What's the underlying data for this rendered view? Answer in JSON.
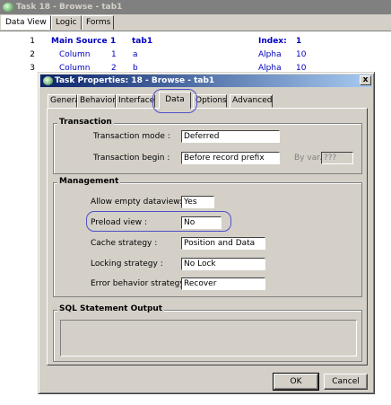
{
  "outer": {
    "title": "Task 18 -  Browse - tab1",
    "tabs": [
      "Data View",
      "Logic",
      "Forms"
    ],
    "rows": [
      {
        "num": "1",
        "c1": "Main Source",
        "c2": "1",
        "c3": "tab1",
        "c4": "Index:",
        "c5": "1"
      },
      {
        "num": "2",
        "c1": "Column",
        "c2": "1",
        "c3": "a",
        "c4": "Alpha",
        "c5": "10"
      },
      {
        "num": "3",
        "c1": "Column",
        "c2": "2",
        "c3": "b",
        "c4": "Alpha",
        "c5": "10"
      }
    ]
  },
  "dialog": {
    "title": "Task Properties: 18 -  Browse - tab1",
    "close_label": "x",
    "tabs": [
      "General",
      "Behavior",
      "Interface",
      "Data",
      "Options",
      "Advanced"
    ],
    "transaction": {
      "title": "Transaction",
      "mode_label": "Transaction mode :",
      "mode_value": "Deferred",
      "begin_label": "Transaction begin :",
      "begin_value": "Before record prefix",
      "byvar_label": "By var.:",
      "byvar_value": "???"
    },
    "management": {
      "title": "Management",
      "allow_empty_label": "Allow empty dataview:",
      "allow_empty_value": "Yes",
      "preload_label": "Preload view :",
      "preload_value": "No",
      "cache_label": "Cache strategy :",
      "cache_value": "Position and Data",
      "locking_label": "Locking strategy :",
      "locking_value": "No Lock",
      "error_label": "Error behavior strategy :",
      "error_value": "Recover"
    },
    "sql": {
      "title": "SQL Statement Output"
    },
    "ok_label": "OK",
    "cancel_label": "Cancel"
  },
  "colors": {
    "title_active": "#0a246a",
    "grid_text": "#0000c0",
    "highlight_oval": "#5050c8"
  }
}
